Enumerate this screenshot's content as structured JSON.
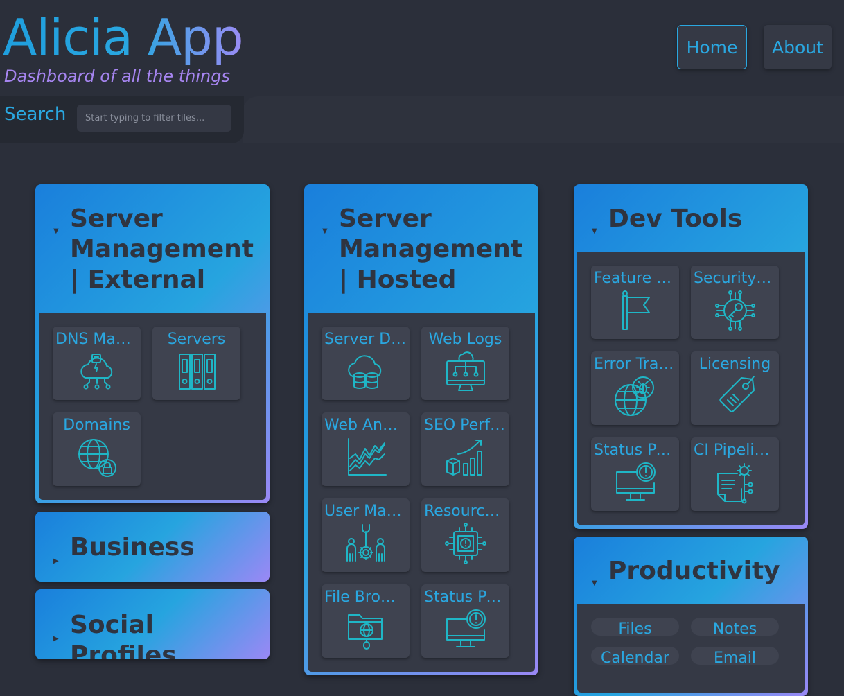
{
  "app": {
    "title": "Alicia App",
    "subtitle": "Dashboard of all the things"
  },
  "nav": {
    "home": "Home",
    "about": "About"
  },
  "search": {
    "label": "Search",
    "placeholder": "Start typing to filter tiles..."
  },
  "colors": {
    "accent": "#2aa7e0",
    "background": "#2b2f3a",
    "tile": "#3f4350",
    "icon": "#1fb6c6",
    "subtitle": "#a685f0"
  },
  "sections": {
    "external": {
      "title": "Server Management | External",
      "tiles": [
        {
          "label": "DNS Management",
          "icon": "cloud-network-icon"
        },
        {
          "label": "Servers",
          "icon": "server-rack-icon"
        },
        {
          "label": "Domains",
          "icon": "globe-lock-icon"
        }
      ]
    },
    "business": {
      "title": "Business"
    },
    "social": {
      "title": "Social Profiles"
    },
    "hosted": {
      "title": "Server Management | Hosted",
      "tiles": [
        {
          "label": "Server Dashboard",
          "icon": "cloud-database-icon"
        },
        {
          "label": "Web Logs",
          "icon": "monitor-network-icon"
        },
        {
          "label": "Web Analytics",
          "icon": "line-chart-icon"
        },
        {
          "label": "SEO Performance",
          "icon": "growth-chart-icon"
        },
        {
          "label": "User Management",
          "icon": "users-gear-icon"
        },
        {
          "label": "Resource Monitor",
          "icon": "chip-alert-icon"
        },
        {
          "label": "File Browser",
          "icon": "folder-globe-icon"
        },
        {
          "label": "Status Page",
          "icon": "monitor-alert-icon"
        }
      ]
    },
    "devtools": {
      "title": "Dev Tools",
      "tiles": [
        {
          "label": "Feature Flags",
          "icon": "flag-icon"
        },
        {
          "label": "Security Keys",
          "icon": "key-circuit-icon"
        },
        {
          "label": "Error Tracking",
          "icon": "globe-bug-icon"
        },
        {
          "label": "Licensing",
          "icon": "price-tag-icon"
        },
        {
          "label": "Status Page",
          "icon": "monitor-alert-icon"
        },
        {
          "label": "CI Pipelines",
          "icon": "document-gear-icon"
        }
      ]
    },
    "productivity": {
      "title": "Productivity",
      "items": [
        "Files",
        "Notes",
        "Calendar",
        "Email"
      ]
    }
  }
}
